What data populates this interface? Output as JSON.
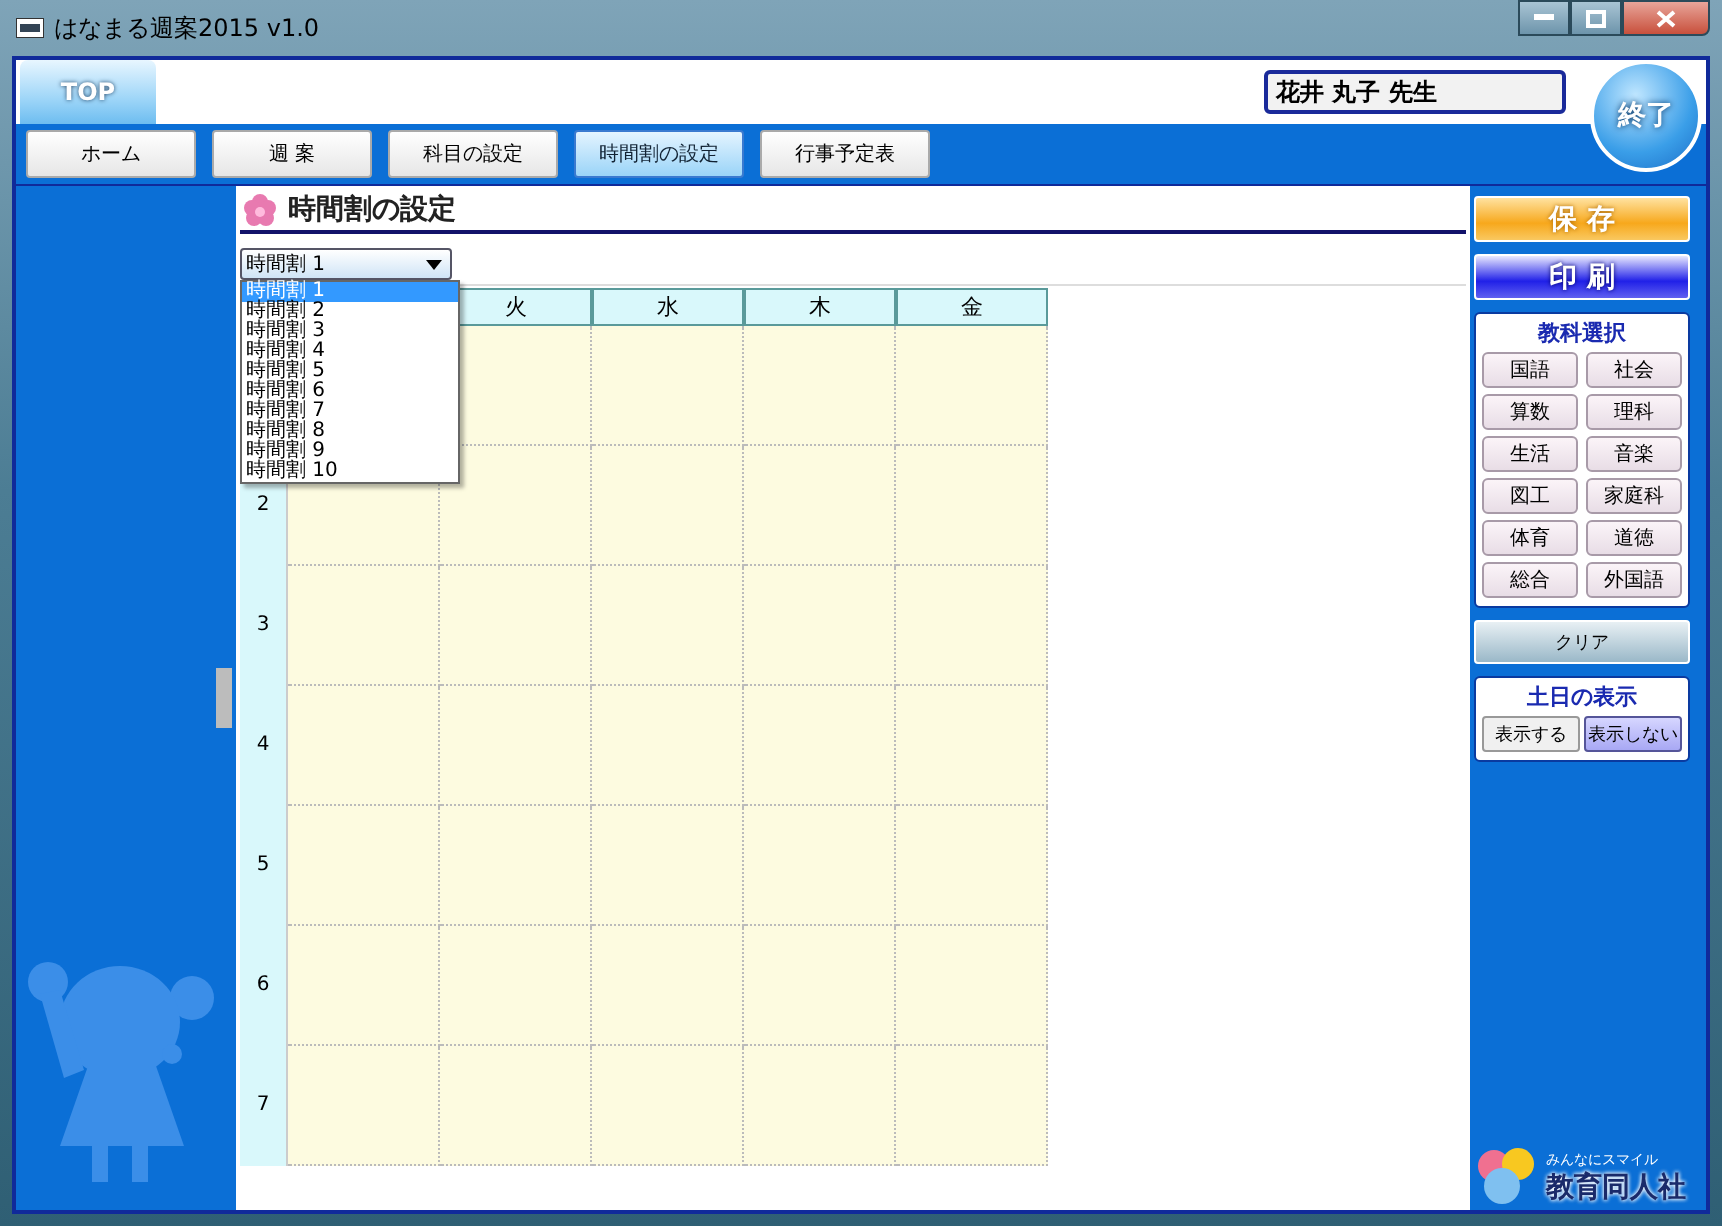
{
  "window": {
    "title": "はなまる週案2015 v1.0"
  },
  "top_tab": {
    "label": "TOP"
  },
  "user_name": "花井 丸子 先生",
  "exit_button": "終了",
  "nav_tabs": [
    {
      "label": "ホーム",
      "selected": false
    },
    {
      "label": "週 案",
      "selected": false
    },
    {
      "label": "科目の設定",
      "selected": false
    },
    {
      "label": "時間割の設定",
      "selected": true
    },
    {
      "label": "行事予定表",
      "selected": false
    }
  ],
  "page": {
    "title": "時間割の設定"
  },
  "timetable_select": {
    "value": "時間割 1",
    "expanded": true,
    "options": [
      {
        "label": "時間割 1",
        "selected": true
      },
      {
        "label": "時間割 2",
        "selected": false
      },
      {
        "label": "時間割 3",
        "selected": false
      },
      {
        "label": "時間割 4",
        "selected": false
      },
      {
        "label": "時間割 5",
        "selected": false
      },
      {
        "label": "時間割 6",
        "selected": false
      },
      {
        "label": "時間割 7",
        "selected": false
      },
      {
        "label": "時間割 8",
        "selected": false
      },
      {
        "label": "時間割 9",
        "selected": false
      },
      {
        "label": "時間割 10",
        "selected": false
      }
    ]
  },
  "timetable": {
    "columns": [
      {},
      {
        "label": "火"
      },
      {
        "label": "水"
      },
      {
        "label": "木"
      },
      {
        "label": "金"
      }
    ],
    "rows": [
      {},
      {
        "label": "2"
      },
      {
        "label": "3"
      },
      {
        "label": "4"
      },
      {
        "label": "5"
      },
      {
        "label": "6"
      },
      {
        "label": "7"
      }
    ]
  },
  "actions": [
    {
      "kind": "save",
      "label": "保 存"
    },
    {
      "kind": "print",
      "label": "印 刷"
    }
  ],
  "subjects": {
    "title": "教科選択",
    "items": [
      "国語",
      "社会",
      "算数",
      "理科",
      "生活",
      "音楽",
      "図工",
      "家庭科",
      "体育",
      "道徳",
      "総合",
      "外国語"
    ]
  },
  "clear_button": "クリア",
  "weekend": {
    "title": "土日の表示",
    "options": [
      {
        "label": "表示する",
        "selected": false
      },
      {
        "label": "表示しない",
        "selected": true
      }
    ]
  },
  "logo": {
    "tagline": "みんなにスマイル",
    "name": "教育同人社"
  }
}
